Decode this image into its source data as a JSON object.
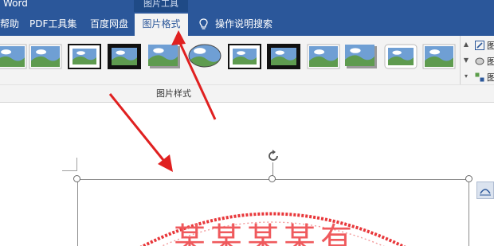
{
  "window": {
    "title_fragment": "Word"
  },
  "context_tab_group": {
    "label": "图片工具"
  },
  "tabs": [
    {
      "label": "帮助"
    },
    {
      "label": "PDF工具集"
    },
    {
      "label": "百度网盘"
    },
    {
      "label": "图片格式",
      "active": true
    }
  ],
  "tell_me": {
    "label": "操作说明搜索"
  },
  "ribbon": {
    "group_label": "图片样式",
    "style_count": 12,
    "side_commands": [
      {
        "label": "图",
        "icon": "pencil-icon"
      },
      {
        "label": "图",
        "icon": "effects-icon"
      },
      {
        "label": "图",
        "icon": "layout-icon"
      }
    ]
  },
  "colors": {
    "ribbon_blue": "#2b579a",
    "ribbon_bg": "#f3f3f3",
    "annotation_arrow": "#e02020",
    "stamp_red": "#e8373a"
  },
  "stamp": {
    "text": "某某某某有"
  }
}
